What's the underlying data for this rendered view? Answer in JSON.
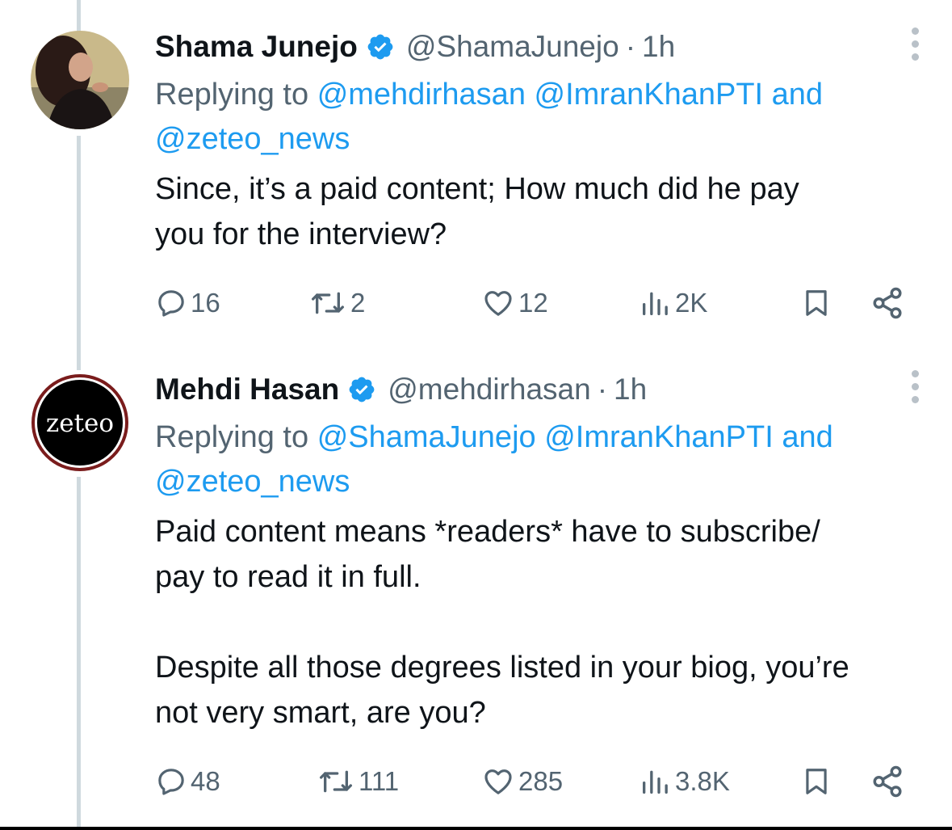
{
  "tweets": [
    {
      "author_name": "Shama Junejo",
      "verified": true,
      "handle": "@ShamaJunejo",
      "separator": "·",
      "time": "1h",
      "replying_prefix": "Replying to",
      "replying_mentions": [
        "@mehdirhasan",
        "@ImranKhanPTI"
      ],
      "replying_and": "and",
      "replying_last": "@zeteo_news",
      "body_lines": [
        "Since, it’s a paid content; How much did he pay",
        "you for the interview?"
      ],
      "stats": {
        "replies": "16",
        "reposts": "2",
        "likes": "12",
        "views": "2K"
      }
    },
    {
      "author_name": "Mehdi Hasan",
      "verified": true,
      "handle": "@mehdirhasan",
      "separator": "·",
      "time": "1h",
      "avatar_text": "zeteo",
      "replying_prefix": "Replying to",
      "replying_mentions": [
        "@ShamaJunejo",
        "@ImranKhanPTI"
      ],
      "replying_and": "and",
      "replying_last": "@zeteo_news",
      "body_lines": [
        "Paid content means *readers* have to subscribe/",
        "pay to read it in full.",
        "",
        "Despite all those degrees listed in your biog, you’re",
        "not very smart, are you?"
      ],
      "stats": {
        "replies": "48",
        "reposts": "111",
        "likes": "285",
        "views": "3.8K"
      }
    }
  ],
  "colors": {
    "link": "#1d9bf0",
    "secondary": "#536471",
    "verified": "#1d9bf0",
    "thread_line": "#cfd9de",
    "zeteo_ring": "#7a1c1c"
  },
  "icons": [
    "reply-icon",
    "repost-icon",
    "like-icon",
    "views-icon",
    "bookmark-icon",
    "share-icon",
    "more-icon",
    "verified-badge-icon"
  ]
}
